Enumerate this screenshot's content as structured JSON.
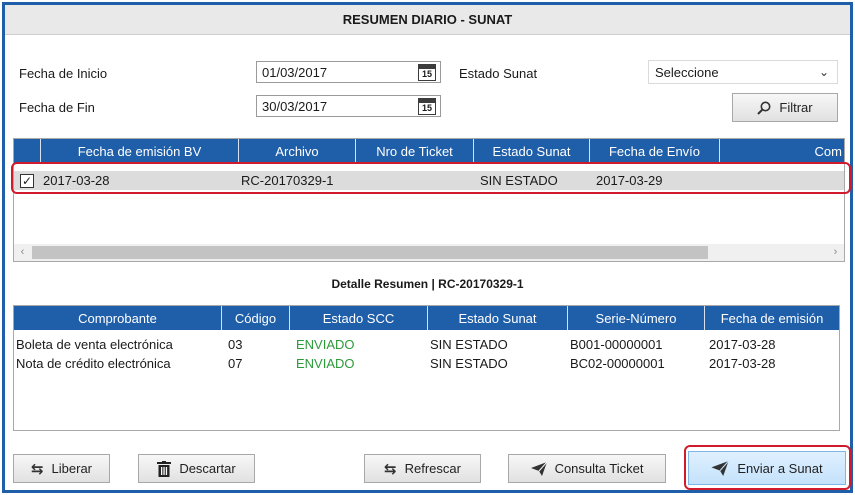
{
  "window": {
    "title": "RESUMEN DIARIO - SUNAT"
  },
  "filters": {
    "fecha_inicio_label": "Fecha de Inicio",
    "fecha_inicio_value": "01/03/2017",
    "fecha_fin_label": "Fecha de Fin",
    "fecha_fin_value": "30/03/2017",
    "calendar_day": "15",
    "estado_label": "Estado Sunat",
    "estado_value": "Seleccione",
    "filtrar_label": "Filtrar"
  },
  "summary_grid": {
    "columns": [
      "Fecha de emisión BV",
      "Archivo",
      "Nro de Ticket",
      "Estado Sunat",
      "Fecha de Envío",
      "Com"
    ],
    "rows": [
      {
        "checked": true,
        "check_glyph": "✓",
        "fecha": "2017-03-28",
        "archivo": "RC-20170329-1",
        "ticket": "",
        "estado": "SIN ESTADO",
        "envio": "2017-03-29",
        "com": ""
      }
    ]
  },
  "detail": {
    "title": "Detalle Resumen | RC-20170329-1",
    "columns": [
      "Comprobante",
      "Código",
      "Estado SCC",
      "Estado Sunat",
      "Serie-Número",
      "Fecha de emisión"
    ],
    "rows": [
      {
        "comprobante": "Boleta de venta electrónica",
        "codigo": "03",
        "estado_scc": "ENVIADO",
        "estado_sunat": "SIN ESTADO",
        "serie": "B001-00000001",
        "fecha": "2017-03-28"
      },
      {
        "comprobante": "Nota de crédito electrónica",
        "codigo": "07",
        "estado_scc": "ENVIADO",
        "estado_sunat": "SIN ESTADO",
        "serie": "BC02-00000001",
        "fecha": "2017-03-28"
      }
    ]
  },
  "actions": {
    "liberar": "Liberar",
    "descartar": "Descartar",
    "refrescar": "Refrescar",
    "consulta": "Consulta Ticket",
    "enviar": "Enviar a Sunat"
  },
  "colors": {
    "header_blue": "#1f5ea8",
    "highlight_red": "#d11b2d",
    "enviado_green": "#2d9a3a"
  }
}
